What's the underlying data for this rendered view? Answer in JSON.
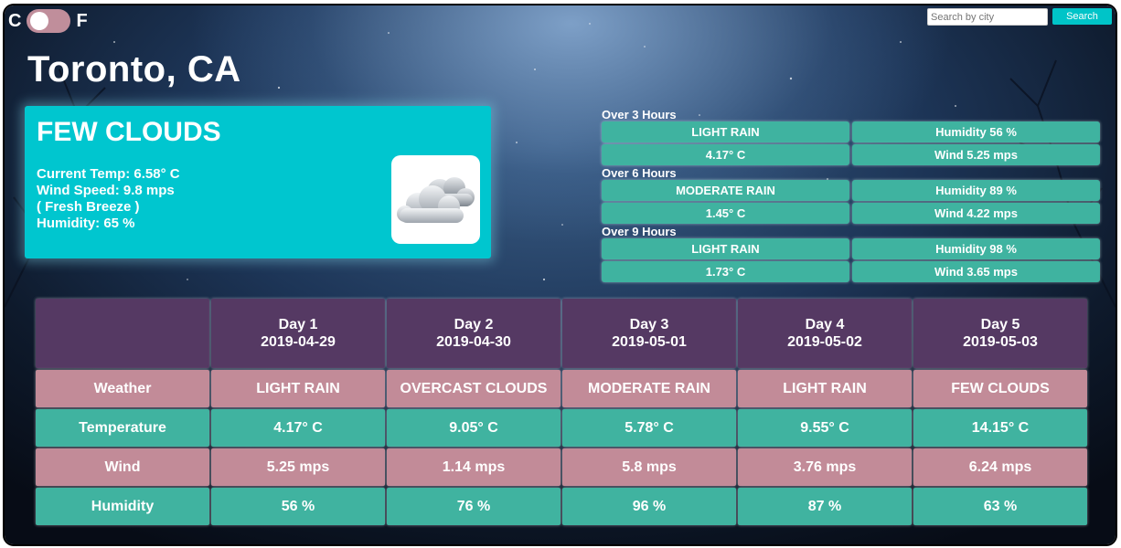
{
  "units": {
    "celsius_label": "C",
    "fahrenheit_label": "F"
  },
  "search": {
    "placeholder": "Search by city",
    "button_label": "Search"
  },
  "city": "Toronto, CA",
  "current": {
    "condition": "FEW CLOUDS",
    "temp_line": "Current Temp: 6.58° C",
    "wind_line": "Wind Speed: 9.8 mps",
    "wind_desc": "( Fresh Breeze )",
    "humidity_line": "Humidity: 65 %",
    "icon": "few-clouds-icon"
  },
  "hourly": [
    {
      "label": "Over 3 Hours",
      "condition": "LIGHT RAIN",
      "humidity": "Humidity 56 %",
      "temp": "4.17° C",
      "wind": "Wind 5.25 mps"
    },
    {
      "label": "Over 6 Hours",
      "condition": "MODERATE RAIN",
      "humidity": "Humidity 89 %",
      "temp": "1.45° C",
      "wind": "Wind 4.22 mps"
    },
    {
      "label": "Over 9 Hours",
      "condition": "LIGHT RAIN",
      "humidity": "Humidity 98 %",
      "temp": "1.73° C",
      "wind": "Wind 3.65 mps"
    }
  ],
  "forecast": {
    "row_labels": {
      "weather": "Weather",
      "temperature": "Temperature",
      "wind": "Wind",
      "humidity": "Humidity"
    },
    "days": [
      {
        "day": "Day 1",
        "date": "2019-04-29",
        "weather": "LIGHT RAIN",
        "temp": "4.17° C",
        "wind": "5.25 mps",
        "humidity": "56 %"
      },
      {
        "day": "Day 2",
        "date": "2019-04-30",
        "weather": "OVERCAST CLOUDS",
        "temp": "9.05° C",
        "wind": "1.14 mps",
        "humidity": "76 %"
      },
      {
        "day": "Day 3",
        "date": "2019-05-01",
        "weather": "MODERATE RAIN",
        "temp": "5.78° C",
        "wind": "5.8 mps",
        "humidity": "96 %"
      },
      {
        "day": "Day 4",
        "date": "2019-05-02",
        "weather": "LIGHT RAIN",
        "temp": "9.55° C",
        "wind": "3.76 mps",
        "humidity": "87 %"
      },
      {
        "day": "Day 5",
        "date": "2019-05-03",
        "weather": "FEW CLOUDS",
        "temp": "14.15° C",
        "wind": "6.24 mps",
        "humidity": "63 %"
      }
    ]
  },
  "colors": {
    "card": "#00c6cf",
    "hourly_cell": "#3fb3a0",
    "header": "#553963",
    "pink_row": "#c28b98",
    "teal_row": "#40b3a0",
    "search_button": "#00c4c8",
    "toggle": "#c08e9b"
  }
}
